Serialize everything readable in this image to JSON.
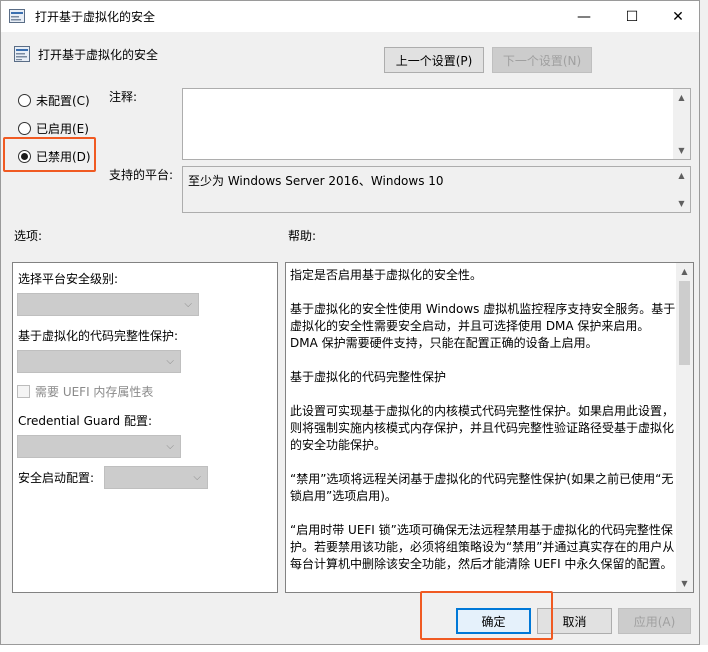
{
  "window": {
    "title": "打开基于虚拟化的安全",
    "minimize_glyph": "—",
    "maximize_glyph": "☐",
    "close_glyph": "✕"
  },
  "header": {
    "policy_name": "打开基于虚拟化的安全",
    "prev_button": "上一个设置(P)",
    "next_button": "下一个设置(N)"
  },
  "state": {
    "options": [
      {
        "label": "未配置(C)",
        "checked": false
      },
      {
        "label": "已启用(E)",
        "checked": false
      },
      {
        "label": "已禁用(D)",
        "checked": true
      }
    ]
  },
  "comment": {
    "label": "注释:",
    "value": ""
  },
  "platform": {
    "label": "支持的平台:",
    "value": "至少为 Windows Server 2016、Windows 10"
  },
  "options_section": {
    "heading": "选项:",
    "platform_level_label": "选择平台安全级别:",
    "code_integrity_label": "基于虚拟化的代码完整性保护:",
    "uefi_checkbox_label": "需要 UEFI 内存属性表",
    "credential_guard_label": "Credential Guard 配置:",
    "secure_launch_label": "安全启动配置:"
  },
  "help_section": {
    "heading": "帮助:",
    "paragraphs": [
      "指定是否启用基于虚拟化的安全性。",
      "基于虚拟化的安全性使用 Windows 虚拟机监控程序支持安全服务。基于虚拟化的安全性需要安全启动，并且可选择使用 DMA 保护来启用。DMA 保护需要硬件支持，只能在配置正确的设备上启用。",
      "基于虚拟化的代码完整性保护",
      "此设置可实现基于虚拟化的内核模式代码完整性保护。如果启用此设置，则将强制实施内核模式内存保护，并且代码完整性验证路径受基于虚拟化的安全功能保护。",
      "“禁用”选项将远程关闭基于虚拟化的代码完整性保护(如果之前已使用“无锁启用”选项启用)。",
      "“启用时带 UEFI 锁”选项可确保无法远程禁用基于虚拟化的代码完整性保护。若要禁用该功能，必须将组策略设为“禁用”并通过真实存在的用户从每台计算机中删除该安全功能，然后才能清除 UEFI 中永久保留的配置。"
    ]
  },
  "footer": {
    "ok_button": "确定",
    "cancel_button": "取消",
    "apply_button": "应用(A)"
  },
  "colors": {
    "highlight": "#f05a22",
    "primary_border": "#0078d7"
  }
}
